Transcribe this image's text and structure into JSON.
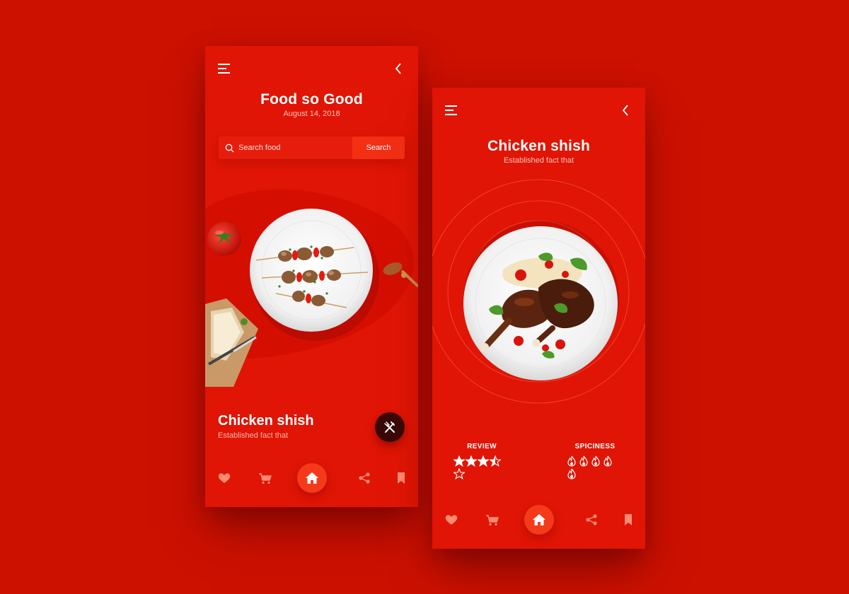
{
  "colors": {
    "background": "#cc1100",
    "phone_background": "#e01505",
    "search_button": "#f32f14",
    "fab": "#3a0806",
    "home_button": "#f53a1c",
    "muted_icon": "#ff8a72"
  },
  "screen1": {
    "title": "Food so Good",
    "date": "August 14, 2018",
    "search": {
      "placeholder": "Search food",
      "button_label": "Search"
    },
    "dish": {
      "name": "Chicken shish",
      "description": "Established fact that"
    },
    "icons": {
      "menu": "menu-icon",
      "back": "chevron-left-icon",
      "fab": "fork-knife-icon"
    }
  },
  "screen2": {
    "title": "Chicken shish",
    "subtitle": "Established fact that",
    "review": {
      "label": "REVIEW",
      "rating": 3.5,
      "max": 5
    },
    "spiciness": {
      "label": "SPICINESS",
      "level": 5,
      "max": 5
    }
  },
  "bottom_nav": {
    "items": [
      "heart-icon",
      "cart-icon",
      "home-icon",
      "share-icon",
      "bookmark-icon"
    ],
    "active": "home-icon"
  }
}
